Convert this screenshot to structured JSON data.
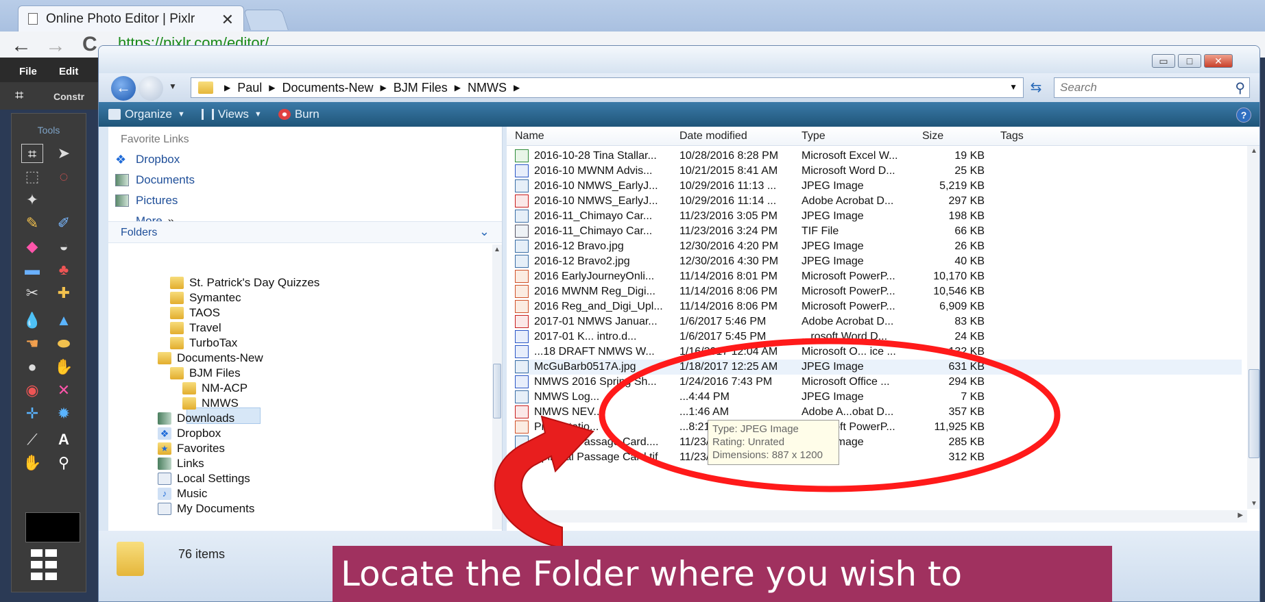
{
  "browser": {
    "tab_title": "Online Photo Editor | Pixlr",
    "tab_close": "✕",
    "url": "https://pixlr.com/editor/"
  },
  "pixlr": {
    "menu": [
      "File",
      "Edit"
    ],
    "option_label": "Constr",
    "tools_title": "Tools"
  },
  "explorer": {
    "breadcrumb": [
      "Paul",
      "Documents-New",
      "BJM Files",
      "NMWS"
    ],
    "search_placeholder": "Search",
    "commands": {
      "organize": "Organize",
      "views": "Views",
      "burn": "Burn"
    },
    "favorite_links_title": "Favorite Links",
    "favorites": [
      "Dropbox",
      "Documents",
      "Pictures"
    ],
    "more_label": "More",
    "folders_title": "Folders",
    "tree": [
      "St. Patrick's Day Quizzes",
      "Symantec",
      "TAOS",
      "Travel",
      "TurboTax",
      "Documents-New",
      "BJM Files",
      "NM-ACP",
      "NMWS",
      "Downloads",
      "Dropbox",
      "Favorites",
      "Links",
      "Local Settings",
      "Music",
      "My Documents"
    ],
    "columns": {
      "name": "Name",
      "date": "Date modified",
      "type": "Type",
      "size": "Size",
      "tags": "Tags"
    },
    "files": [
      {
        "name": "2016-10-28 Tina Stallar...",
        "date": "10/28/2016 8:28 PM",
        "type": "Microsoft Excel W...",
        "size": "19 KB",
        "icon": "excel-icon"
      },
      {
        "name": "2016-10 MWNM Advis...",
        "date": "10/21/2015 8:41 AM",
        "type": "Microsoft Word D...",
        "size": "25 KB",
        "icon": "word-icon"
      },
      {
        "name": "2016-10 NMWS_EarlyJ...",
        "date": "10/29/2016 11:13 ...",
        "type": "JPEG Image",
        "size": "5,219 KB",
        "icon": "image-icon"
      },
      {
        "name": "2016-10 NMWS_EarlyJ...",
        "date": "10/29/2016 11:14 ...",
        "type": "Adobe Acrobat D...",
        "size": "297 KB",
        "icon": "pdf-icon"
      },
      {
        "name": "2016-11_Chimayo Car...",
        "date": "11/23/2016 3:05 PM",
        "type": "JPEG Image",
        "size": "198 KB",
        "icon": "image-icon"
      },
      {
        "name": "2016-11_Chimayo Car...",
        "date": "11/23/2016 3:24 PM",
        "type": "TIF File",
        "size": "66 KB",
        "icon": "tif-icon"
      },
      {
        "name": "2016-12 Bravo.jpg",
        "date": "12/30/2016 4:20 PM",
        "type": "JPEG Image",
        "size": "26 KB",
        "icon": "image-icon"
      },
      {
        "name": "2016-12 Bravo2.jpg",
        "date": "12/30/2016 4:30 PM",
        "type": "JPEG Image",
        "size": "40 KB",
        "icon": "image-icon"
      },
      {
        "name": "2016 EarlyJourneyOnli...",
        "date": "11/14/2016 8:01 PM",
        "type": "Microsoft PowerP...",
        "size": "10,170 KB",
        "icon": "powerpoint-icon"
      },
      {
        "name": "2016 MWNM Reg_Digi...",
        "date": "11/14/2016 8:06 PM",
        "type": "Microsoft PowerP...",
        "size": "10,546 KB",
        "icon": "powerpoint-icon"
      },
      {
        "name": "2016 Reg_and_Digi_Upl...",
        "date": "11/14/2016 8:06 PM",
        "type": "Microsoft PowerP...",
        "size": "6,909 KB",
        "icon": "powerpoint-icon"
      },
      {
        "name": "2017-01  NMWS Januar...",
        "date": "1/6/2017 5:46 PM",
        "type": "Adobe Acrobat D...",
        "size": "83 KB",
        "icon": "pdf-icon"
      },
      {
        "name": "2017-01 K... intro.d...",
        "date": "1/6/2017 5:45 PM",
        "type": "...rosoft Word D...",
        "size": "24 KB",
        "icon": "word-icon"
      },
      {
        "name": "...18 DRAFT NMWS W...",
        "date": "1/16/2017 12:04 AM",
        "type": "Microsoft O... ice ...",
        "size": "132 KB",
        "icon": "word-icon"
      },
      {
        "name": "McGuBarb0517A.jpg",
        "date": "1/18/2017 12:25 AM",
        "type": "JPEG Image",
        "size": "631 KB",
        "icon": "image-icon"
      },
      {
        "name": "NMWS 2016 Spring Sh...",
        "date": "1/24/2016 7:43 PM",
        "type": "Microsoft Office ...",
        "size": "294 KB",
        "icon": "word-icon"
      },
      {
        "name": "NMWS Log...",
        "date": "...4:44 PM",
        "type": "JPEG Image",
        "size": "7 KB",
        "icon": "image-icon"
      },
      {
        "name": "NMWS NEV...",
        "date": "...1:46 AM",
        "type": "Adobe A...obat D...",
        "size": "357 KB",
        "icon": "pdf-icon"
      },
      {
        "name": "Presentatio...",
        "date": "...8:21 PM",
        "type": "...icrosoft PowerP...",
        "size": "11,925 KB",
        "icon": "powerpoint-icon"
      },
      {
        "name": "Spiritual Passage Card....",
        "date": "11/23/2016 5:54 PM",
        "type": "JPEG Image",
        "size": "285 KB",
        "icon": "image-icon"
      },
      {
        "name": "Spiritual Passage Card.tif",
        "date": "11/23/2016 5:53 PM",
        "type": "TIF File",
        "size": "312 KB",
        "icon": "tif-icon"
      }
    ],
    "tooltip": [
      "Type: JPEG Image",
      "Rating: Unrated",
      "Dimensions: 887 x 1200"
    ],
    "status": "76 items"
  },
  "caption": "Locate the Folder where you wish to"
}
